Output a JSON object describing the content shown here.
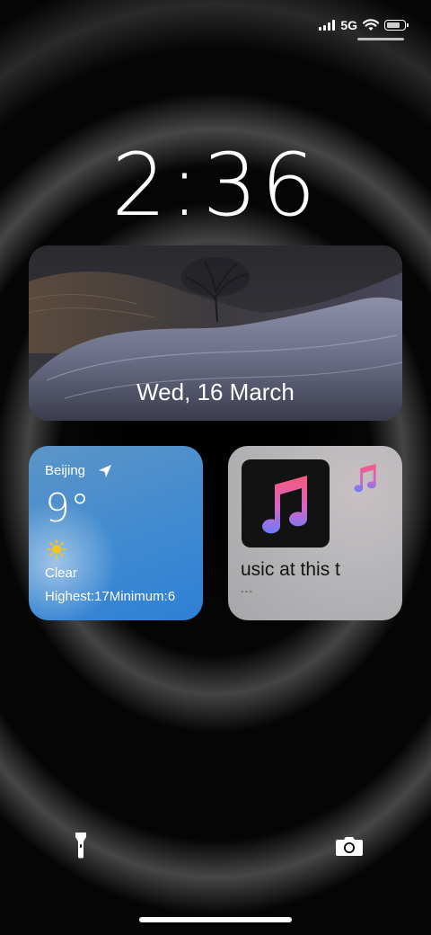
{
  "status_bar": {
    "network": "5G",
    "icons": [
      "signal-bars-icon",
      "wifi-icon",
      "battery-icon"
    ],
    "battery_level": 0.9
  },
  "lock_screen": {
    "time": "2:36"
  },
  "photo_widget": {
    "date": "Wed, 16 March"
  },
  "weather_widget": {
    "city": "Beijing",
    "temperature": "9°",
    "condition": "Clear",
    "range": "Highest:17Minimum:6",
    "icons": [
      "location-arrow-icon",
      "sun-icon"
    ]
  },
  "music_widget": {
    "title": "usic at this t",
    "subtitle": "---",
    "icons": [
      "apple-music-icon",
      "music-note-icon"
    ]
  },
  "bottom_controls": {
    "icons": [
      "flashlight-icon",
      "camera-icon"
    ]
  },
  "colors": {
    "weather_blue": "#3f8ad0",
    "music_gray": "#b6b6b8",
    "note_pink": "#f4516e",
    "note_purple": "#7b6df5"
  }
}
